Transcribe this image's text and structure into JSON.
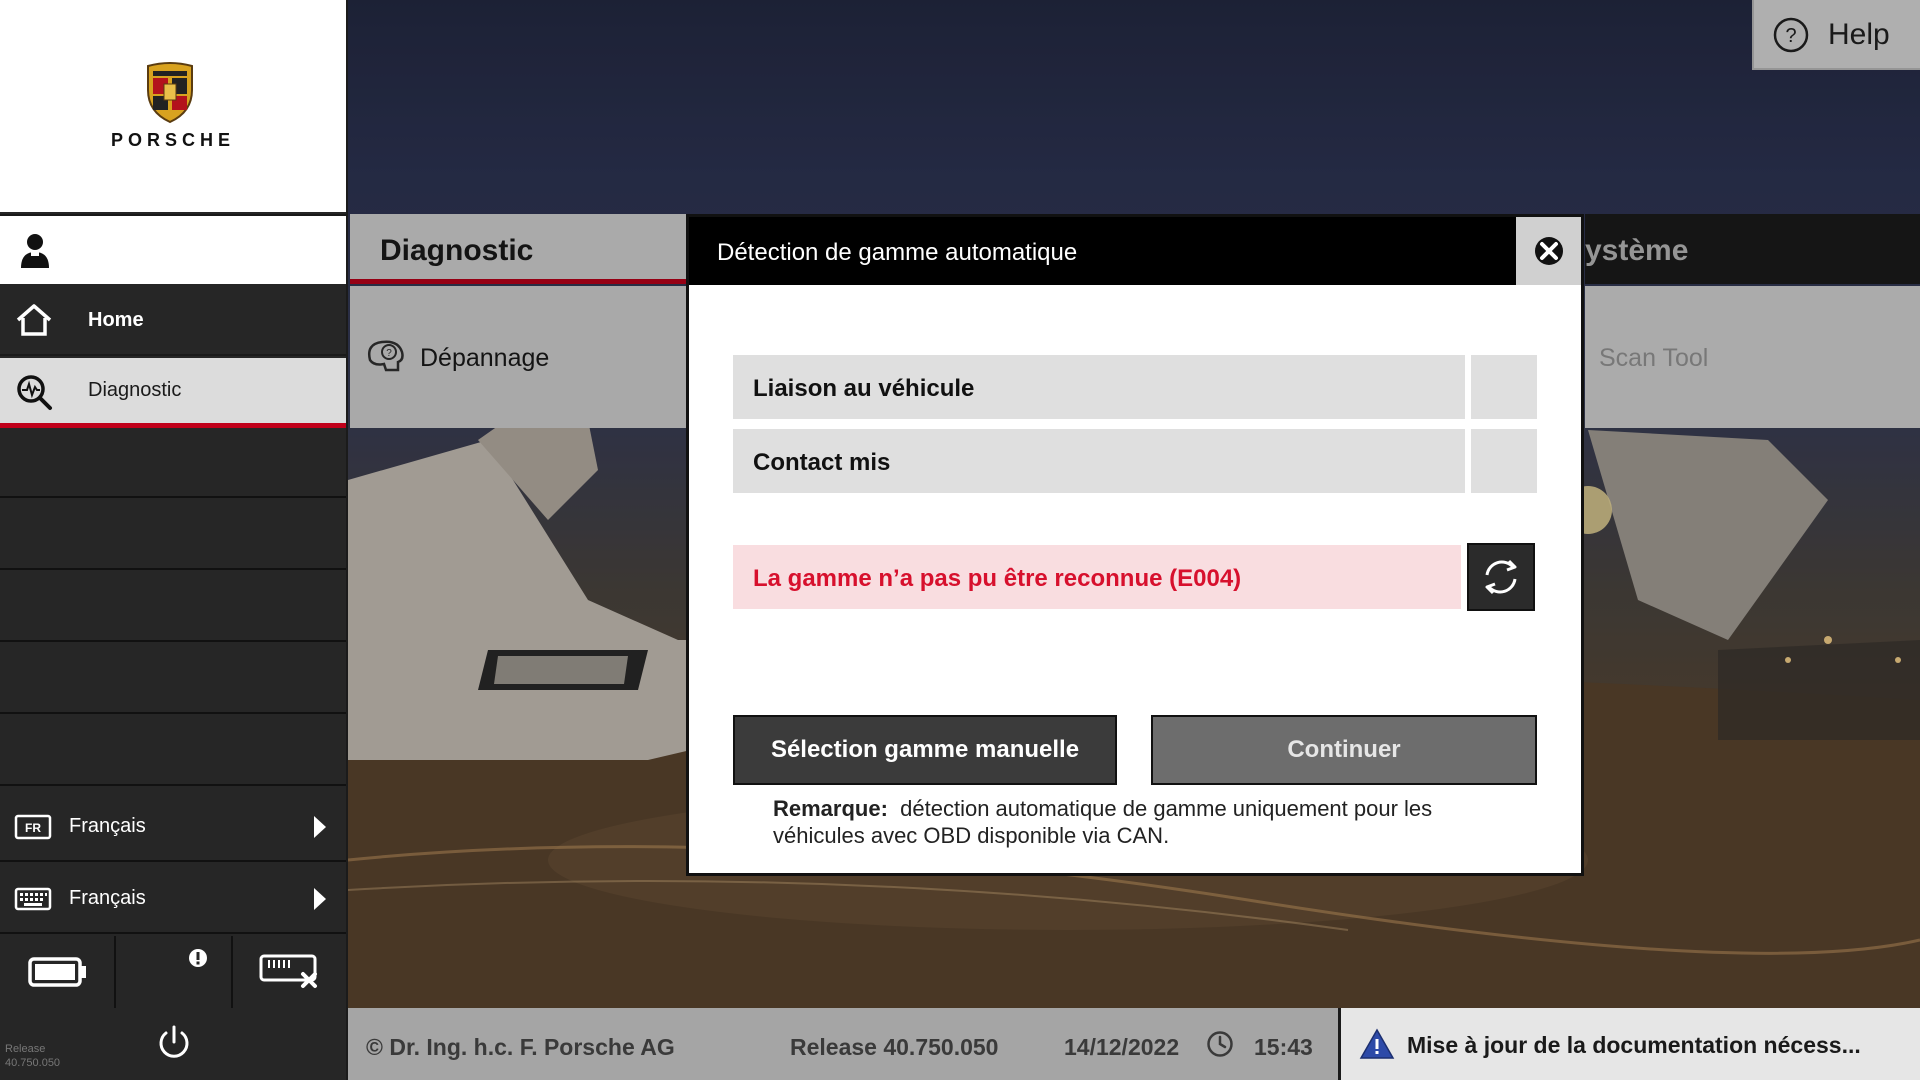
{
  "brand": {
    "wordmark": "PORSCHE"
  },
  "help": {
    "label": "Help",
    "icon": "help-circle-icon"
  },
  "sidebar": {
    "nav": [
      {
        "label": "Home",
        "icon": "home-icon"
      },
      {
        "label": "Diagnostic",
        "icon": "diagnostic-search-icon"
      }
    ],
    "language_ui": {
      "code": "FR",
      "label": "Français"
    },
    "language_keyboard": {
      "label": "Français"
    },
    "release_small": "Release\n40.750.050"
  },
  "tabs": {
    "diagnostic": "Diagnostic",
    "systeme": "ystème"
  },
  "tiles": {
    "depannage": "Dépannage",
    "scan_tool": "Scan Tool"
  },
  "modal": {
    "title": "Détection de gamme automatique",
    "rows": [
      {
        "label": "Liaison au véhicule"
      },
      {
        "label": "Contact mis"
      }
    ],
    "error": "La gamme n’a pas pu être reconnue (E004)",
    "btn_manual": "Sélection gamme manuelle",
    "btn_continue": "Continuer",
    "remark_label": "Remarque:",
    "remark_text": "détection automatique de gamme uniquement pour les véhicules avec OBD disponible via CAN."
  },
  "footer": {
    "copyright": "© Dr. Ing. h.c. F. Porsche AG",
    "release": "Release 40.750.050",
    "date": "14/12/2022",
    "time": "15:43",
    "notice": "Mise à jour de la documentation nécess..."
  },
  "colors": {
    "accent_red": "#c0001a",
    "error_red": "#d7102d",
    "error_bg": "#f9dde0",
    "warning_blue": "#2d4aa8"
  }
}
